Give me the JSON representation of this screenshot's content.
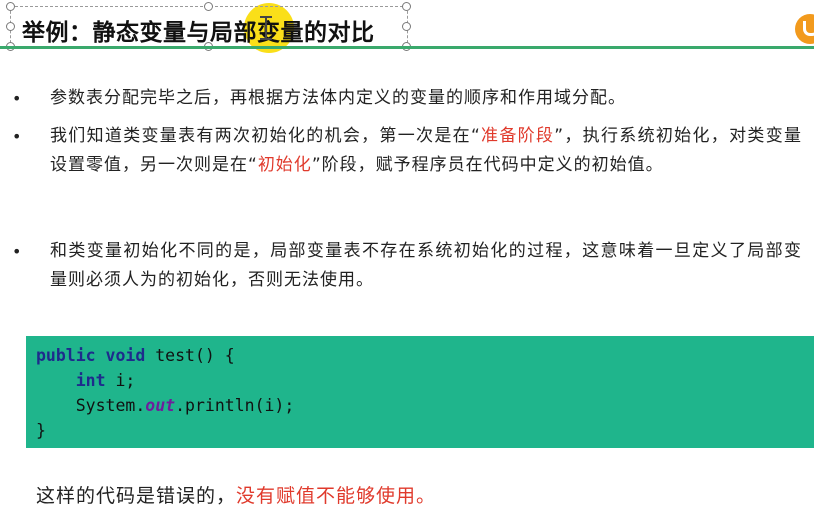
{
  "title": {
    "before": "举例：静态变量与局",
    "highlight": "部",
    "after": "变量的对比"
  },
  "bullets": [
    {
      "marker": "•",
      "text": "参数表分配完毕之后，再根据方法体内定义的变量的顺序和作用域分配。"
    },
    {
      "marker": "•",
      "part1": "我们知道类变量表有两次初始化的机会，第一次是在“",
      "red1": "准备阶段",
      "part2": "”，执行系统初始化，对类变量设置零值，另一次则是在“",
      "red2": "初始化",
      "part3": "”阶段，赋予程序员在代码中定义的初始值。"
    },
    {
      "marker": "•",
      "text": "和类变量初始化不同的是，局部变量表不存在系统初始化的过程，这意味着一旦定义了局部变量则必须人为的初始化，否则无法使用。"
    }
  ],
  "code": {
    "line1_kw": "public void",
    "line1_rest": " test() {",
    "line2_indent": "    ",
    "line2_kw": "int",
    "line2_rest": " i;",
    "line3_start": "    System.",
    "line3_field": "out",
    "line3_rest": ".println(i);",
    "line4": "}"
  },
  "conclusion": {
    "normal": "这样的代码是错误的，",
    "red": "没有赋值不能够使用。"
  },
  "colors": {
    "accent_green": "#3aa96c",
    "code_bg": "#1fb58c",
    "red_text": "#e03a2c",
    "cursor_highlight": "#fadc00",
    "logo_orange": "#f29a1d"
  },
  "icons": [
    "text-cursor-icon",
    "logo-icon"
  ]
}
